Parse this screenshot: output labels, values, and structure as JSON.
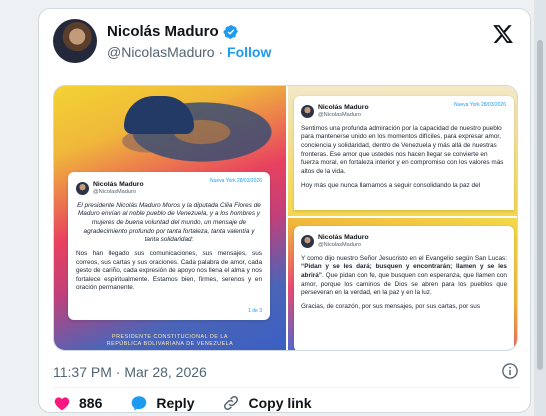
{
  "tweet": {
    "author_name": "Nicolás Maduro",
    "handle": "@NicolasMaduro",
    "separator": "·",
    "follow_label": "Follow",
    "timestamp": "11:37 PM · Mar 28, 2026"
  },
  "actions": {
    "likes_count": "886",
    "reply_label": "Reply",
    "copy_link_label": "Copy link"
  },
  "images": {
    "left": {
      "post_name": "Nicolás Maduro",
      "post_handle": "@NicolasMaduro",
      "post_tag": "Nueva York 28/03/2026",
      "para1": "El presidente Nicolás Maduro Moros y la diputada Cilia Flores de Maduro envían al noble pueblo de Venezuela, y a los hombres y mujeres de buena voluntad del mundo, un mensaje de agradecimiento profundo por tanta fortaleza, tanta valentía y tanta solidaridad:",
      "para2": "Nos han llegado sus comunicaciones, sus mensajes, sus correos, sus cartas y sus oraciones. Cada palabra de amor, cada gesto de cariño, cada expresión de apoyo nos llena el alma y nos fortalece espiritualmente. Estamos bien, firmes, serenos y en oración permanente.",
      "page": "1 de 3",
      "footer_line1": "PRESIDENTE CONSTITUCIONAL DE LA",
      "footer_line2": "REPÚBLICA BOLIVARIANA DE VENEZUELA"
    },
    "top_right": {
      "post_name": "Nicolás Maduro",
      "post_handle": "@NicolasMaduro",
      "post_tag": "Nueva York 28/03/2026",
      "para1": "Sentimos una profunda admiración por la capacidad de nuestro pueblo para mantenerse unido en los momentos difíciles, para expresar amor, conciencia y solidaridad, dentro de Venezuela y más allá de nuestras fronteras. Ese amor que ustedes nos hacen llegar se convierte en fuerza moral, en fortaleza interior y en compromiso con los valores más altos de la vida.",
      "para2": "Hoy más que nunca llamamos a seguir consolidando la paz del"
    },
    "bottom_right": {
      "post_name": "Nicolás Maduro",
      "post_handle": "@NicolasMaduro",
      "para1_start": "Y como dijo nuestro Señor Jesucristo en el Evangelio según San Lucas: ",
      "para1_quote": "“Pidan y se les dará; busquen y encontrarán; llamen y se les abrirá”",
      "para1_end": ". Que pidan con fe, que busquen con esperanza, que llamen con amor, porque los caminos de Dios se abren para los pueblos que perseveran en la verdad, en la paz y en la luz.",
      "para2": "Gracias, de corazón, por sus mensajes, por sus cartas, por sus"
    }
  },
  "colors": {
    "accent": "#1d9bf0",
    "like": "#f91880",
    "text_primary": "#0f1419",
    "text_secondary": "#536471"
  },
  "icons": [
    "verified-badge-icon",
    "x-logo-icon",
    "info-icon",
    "heart-icon",
    "reply-icon",
    "link-icon"
  ]
}
